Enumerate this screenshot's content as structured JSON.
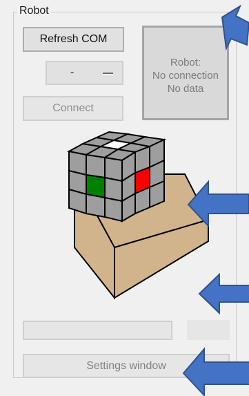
{
  "groupbox": {
    "title": "Robot"
  },
  "buttons": {
    "refresh": "Refresh COM",
    "connect": "Connect",
    "settings": "Settings window"
  },
  "com_port_dropdown": {
    "selected": "-"
  },
  "status": {
    "line1": "Robot:",
    "line2": "No connection",
    "line3": "No data"
  },
  "progress": {
    "value": 0
  },
  "icons": {
    "robot_illustration": "rubiks-cube-robot-illustration",
    "dropdown_arrow": "chevron-down-icon",
    "annotation_arrow": "arrow-left-icon"
  },
  "colors": {
    "cube_gray": "#9e9e9e",
    "cube_white": "#ffffff",
    "cube_green": "#008000",
    "cube_red": "#ff0000",
    "box_tan": "#d2b48c",
    "arrow_blue": "#4472c4",
    "progress_green": "#06b025"
  }
}
